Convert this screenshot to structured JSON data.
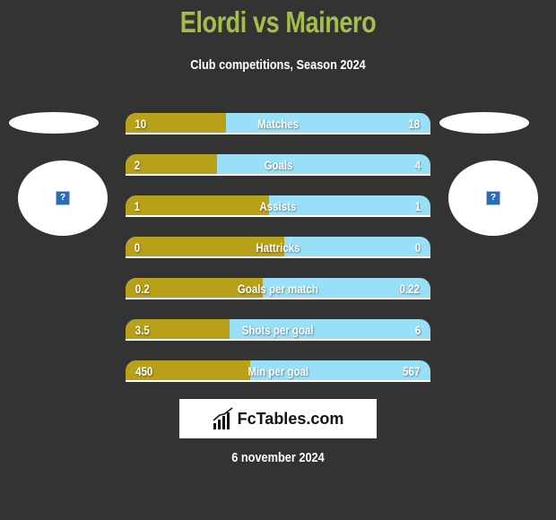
{
  "header": {
    "title": "Elordi vs Mainero",
    "subtitle": "Club competitions, Season 2024"
  },
  "players": {
    "left": {
      "name": "Elordi",
      "logo_icon": "broken-image-icon"
    },
    "right": {
      "name": "Mainero",
      "logo_icon": "broken-image-icon"
    }
  },
  "colors": {
    "title": "#a4be4a",
    "left_bar": "#b8a018",
    "right_bar": "#98e0f8",
    "background": "#333333"
  },
  "stats": [
    {
      "label": "Matches",
      "left": "10",
      "right": "18",
      "left_share": 0.33
    },
    {
      "label": "Goals",
      "left": "2",
      "right": "4",
      "left_share": 0.3
    },
    {
      "label": "Assists",
      "left": "1",
      "right": "1",
      "left_share": 0.47
    },
    {
      "label": "Hattricks",
      "left": "0",
      "right": "0",
      "left_share": 0.52
    },
    {
      "label": "Goals per match",
      "left": "0.2",
      "right": "0.22",
      "left_share": 0.45
    },
    {
      "label": "Shots per goal",
      "left": "3.5",
      "right": "6",
      "left_share": 0.34
    },
    {
      "label": "Min per goal",
      "left": "450",
      "right": "567",
      "left_share": 0.41
    }
  ],
  "brand": {
    "name": "FcTables.com",
    "icon": "chart-bars-icon"
  },
  "footer": {
    "date": "6 november 2024"
  }
}
